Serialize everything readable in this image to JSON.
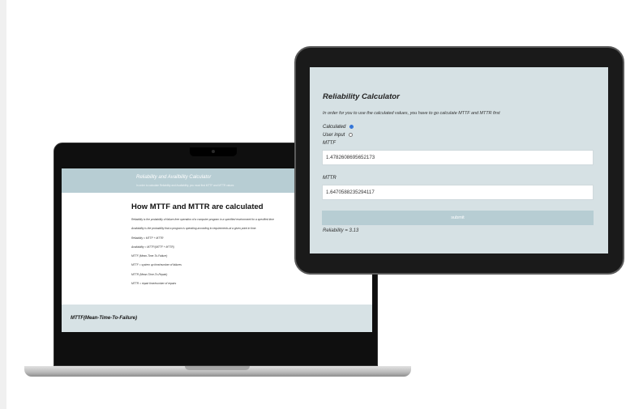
{
  "laptop": {
    "header": {
      "title": "Reliability and Availbility Calculator",
      "subtitle": "In order to calculate Reliability and Availability, you must first MTTF and MTTR values"
    },
    "heading": "How MTTF and MTTR are calculated",
    "lines": [
      "Reliability is the probability of failure-free operation of a computer program in a specified environment for a specified time",
      "Availability is the probability that a program is operating according to requirements at a given point in time.",
      "Reliability = MTTF + MTTR",
      "Availability = MTTF/(MTTF + MTTR)",
      "MTTF (Mean-Time-To-Failure)",
      "MTTF = system up time/number of failures",
      "MTTR (Mean-Time-To-Repair)",
      "MTTR = repair time/number of repairs"
    ],
    "footer_title": "MTTF(Mean-Time-To-Failure)"
  },
  "tablet": {
    "title": "Reliability Calculator",
    "description": "In order for you to use the calculated values, you have to go calculate MTTF and MTTR first",
    "radio_calculated_label": "Calculated",
    "radio_calculated_checked": true,
    "radio_user_input_label": "User input",
    "radio_user_input_checked": false,
    "mttf_label": "MTTF",
    "mttf_value": "1.4782608695652173",
    "mttr_label": "MTTR",
    "mttr_value": "1.6470588235294117",
    "submit_label": "submit",
    "result_text": "Reliability = 3.13"
  }
}
